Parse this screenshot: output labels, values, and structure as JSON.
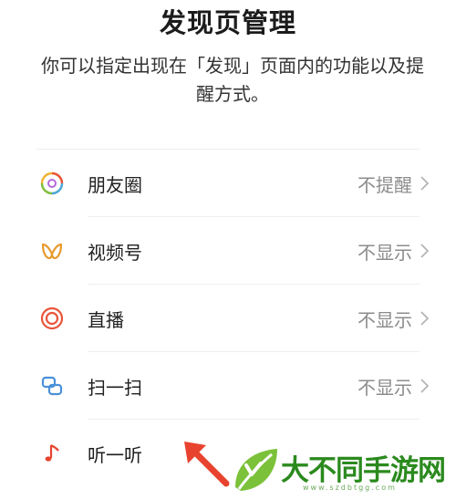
{
  "header": {
    "title": "发现页管理",
    "description": "你可以指定出现在「发现」页面内的功能以及提醒方式。"
  },
  "items": [
    {
      "label": "朋友圈",
      "status": "不提醒",
      "icon": "moments-icon"
    },
    {
      "label": "视频号",
      "status": "不显示",
      "icon": "channels-icon"
    },
    {
      "label": "直播",
      "status": "不显示",
      "icon": "live-icon"
    },
    {
      "label": "扫一扫",
      "status": "不显示",
      "icon": "scan-icon"
    },
    {
      "label": "听一听",
      "status": "",
      "icon": "music-note-icon"
    }
  ],
  "watermark": {
    "name": "大不同手游网",
    "url": "www.szdbtgg.com"
  },
  "colors": {
    "accent_red": "#e8432e",
    "channels_orange": "#e89a2c",
    "watermark_green": "#2b8a1e"
  }
}
